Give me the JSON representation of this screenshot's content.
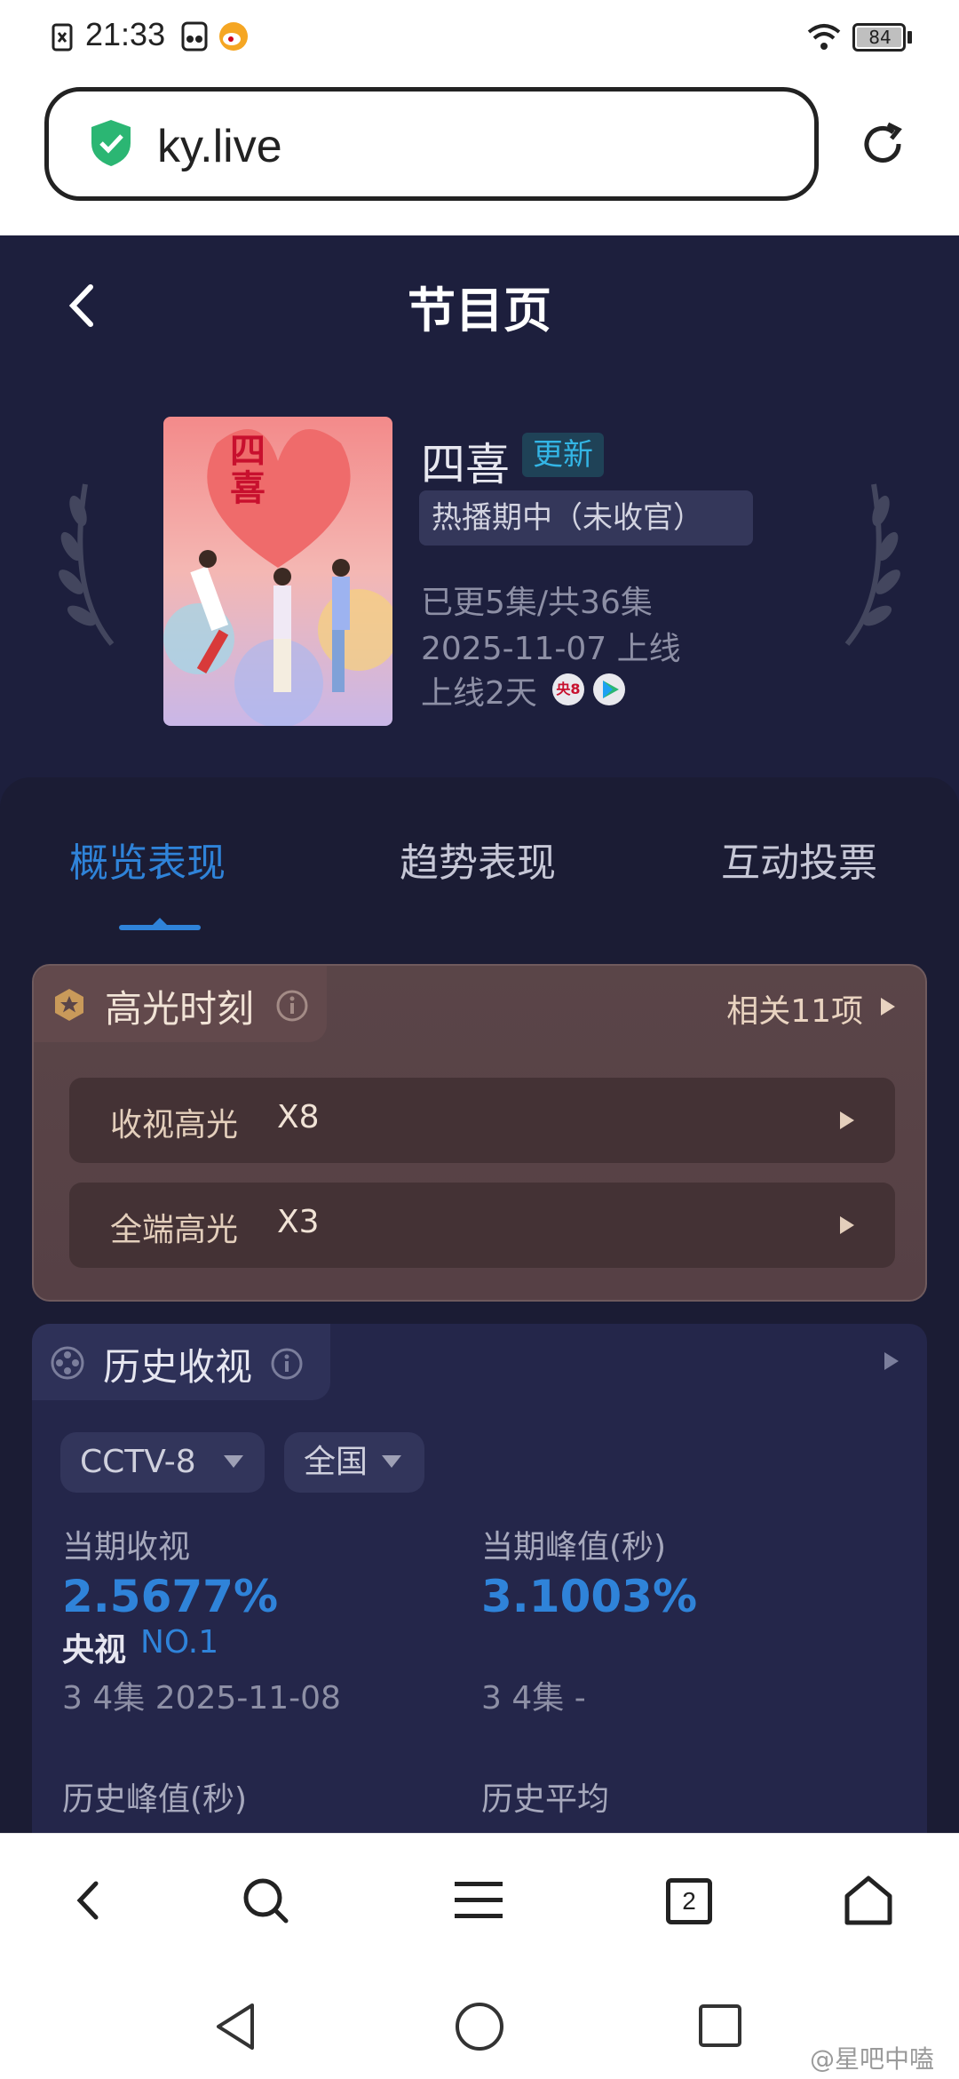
{
  "status_bar": {
    "time": "21:33",
    "battery": "84"
  },
  "browser": {
    "url": "ky.live",
    "tab_count": "2"
  },
  "page": {
    "title": "节目页",
    "show": {
      "name": "四喜",
      "update_badge": "更新",
      "status_tag": "热播期中（未收官）",
      "episodes": "已更5集/共36集",
      "air_date": "2025-11-07 上线",
      "days_online": "上线2天",
      "poster_text": "四喜",
      "channel_badge": "央8"
    },
    "tabs": [
      "概览表现",
      "趋势表现",
      "互动投票"
    ],
    "highlights": {
      "title": "高光时刻",
      "related": "相关11项",
      "rows": [
        {
          "label": "收视高光",
          "value": "X8"
        },
        {
          "label": "全端高光",
          "value": "X3"
        }
      ]
    },
    "history": {
      "title": "历史收视",
      "channel_select": "CCTV-8",
      "region_select": "全国",
      "current_rating_label": "当期收视",
      "current_rating_value": "2.5677%",
      "rank_prefix": "央视",
      "rank_value": "NO.1",
      "current_rating_sub": "3 4集 2025-11-08",
      "peak_label": "当期峰值(秒)",
      "peak_value": "3.1003%",
      "peak_sub": "3 4集 -",
      "hist_peak_label": "历史峰值(秒)",
      "hist_avg_label": "历史平均"
    }
  },
  "watermark": "@星吧中嗑",
  "colors": {
    "accent_blue": "#2f83d9",
    "page_bg": "#1d1f3d",
    "highlight_bg": "#5a4548",
    "secure_green": "#2bb673"
  }
}
